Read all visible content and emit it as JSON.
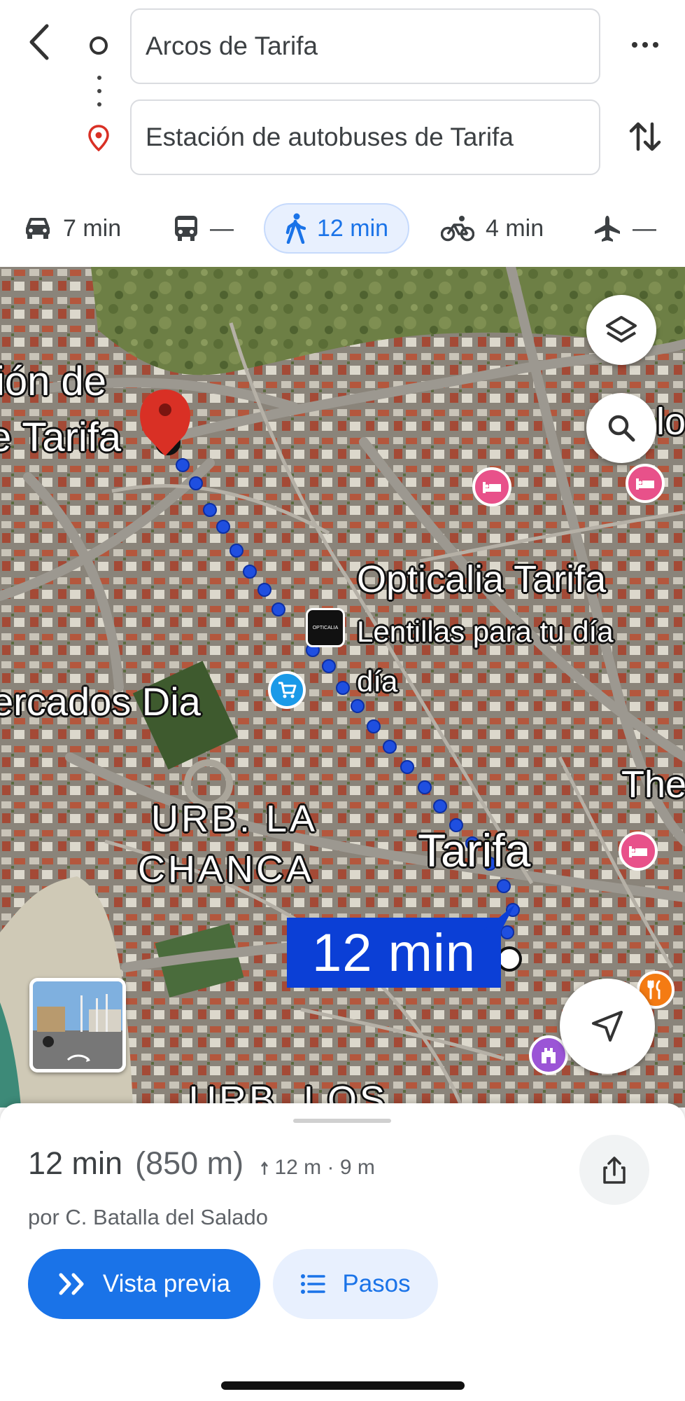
{
  "header": {
    "origin_value": "Arcos de Tarifa",
    "destination_value": "Estación de autobuses de Tarifa"
  },
  "modes": [
    {
      "name": "car",
      "label": "7 min"
    },
    {
      "name": "transit",
      "label": "—"
    },
    {
      "name": "walk",
      "label": "12 min",
      "active": true
    },
    {
      "name": "bike",
      "label": "4 min"
    },
    {
      "name": "flight",
      "label": "—"
    }
  ],
  "map": {
    "labels": {
      "station_line1": "ión de",
      "station_line2": "e Tarifa",
      "opticalia_name": "Opticalia Tarifa",
      "opticalia_desc1": "Lentillas para tu día",
      "opticalia_desc2": "día",
      "opticalia_logo": "OPTICALIA",
      "supermarket": "ercados Dia",
      "urb_line1": "URB. LA",
      "urb_line2": "CHANCA",
      "town": "Tarifa",
      "edge_right_top": "lo",
      "edge_right_mid": "The",
      "edge_bottom": "URB. LOS"
    },
    "route_time_badge": "12 min"
  },
  "sheet": {
    "time": "12 min",
    "distance": "(850 m)",
    "elevation": "12 m · 9 m",
    "via": "por C. Batalla del Salado",
    "preview_label": "Vista previa",
    "steps_label": "Pasos"
  },
  "colors": {
    "accent": "#1a73e8",
    "route_dot": "#1f4fe0",
    "badge": "#0b3fd6",
    "pin": "#d93025",
    "poi_hotel": "#e8518a",
    "poi_shop": "#1a9ae8",
    "poi_food": "#f47b13",
    "poi_landmark": "#9b55d6"
  }
}
